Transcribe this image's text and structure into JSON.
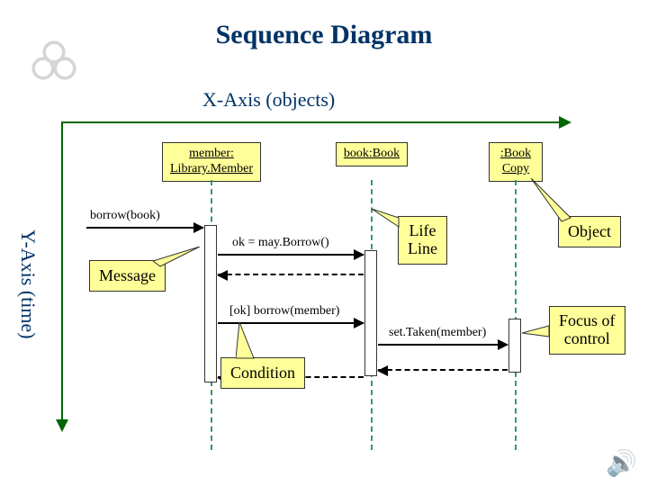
{
  "title": "Sequence Diagram",
  "axes": {
    "x": "X-Axis (objects)",
    "y": "Y-Axis (time)"
  },
  "objects": {
    "member": "member:\nLibrary.Member",
    "book": "book:Book",
    "copy": ":Book\nCopy"
  },
  "messages": {
    "borrow": "borrow(book)",
    "mayBorrow": "ok = may.Borrow()",
    "okBorrow": "[ok] borrow(member)",
    "setTaken": "set.Taken(member)"
  },
  "callouts": {
    "message": "Message",
    "lifeline": "Life\nLine",
    "object": "Object",
    "focus": "Focus of\ncontrol",
    "condition": "Condition"
  }
}
